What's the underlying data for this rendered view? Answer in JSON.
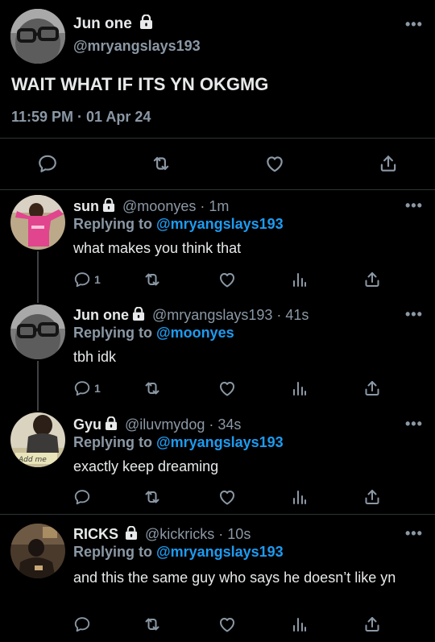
{
  "main_tweet": {
    "author_name": "Jun one",
    "author_handle": "@mryangslays193",
    "text": "WAIT WHAT IF ITS YN OKGMG",
    "timestamp": "11:59 PM · 01 Apr 24"
  },
  "replies": [
    {
      "author_name": "sun",
      "handle_time": "@moonyes · 1m",
      "replying_label": "Replying to",
      "replying_to": "@mryangslays193",
      "text": "what makes you think that",
      "reply_count": "1"
    },
    {
      "author_name": "Jun one",
      "handle_time": "@mryangslays193 · 41s",
      "replying_label": "Replying to",
      "replying_to": "@moonyes",
      "text": "tbh idk",
      "reply_count": "1"
    },
    {
      "author_name": "Gyu",
      "handle_time": "@iluvmydog · 34s",
      "replying_label": "Replying to",
      "replying_to": "@mryangslays193",
      "text": "exactly keep dreaming",
      "avatar_text": "Add me",
      "reply_count": ""
    },
    {
      "author_name": "RICKS",
      "handle_time": "@kickricks · 10s",
      "replying_label": "Replying to",
      "replying_to": "@mryangslays193",
      "text": "and this the same guy who says he doesn’t like yn",
      "reply_count": ""
    }
  ],
  "more_glyph": "•••",
  "colors": {
    "background": "#000000",
    "accent": "#1d9bf0",
    "muted": "#8b98a5",
    "text": "#e7e9ea"
  }
}
